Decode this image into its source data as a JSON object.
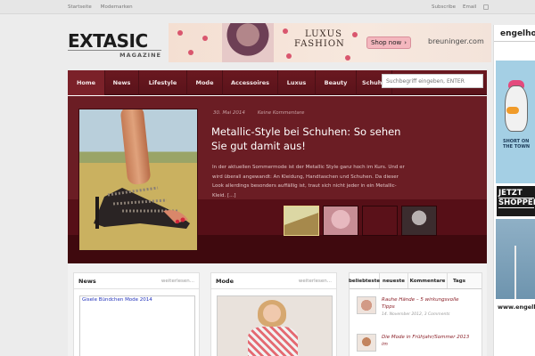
{
  "topbar": {
    "left_links": [
      "Startseite",
      "Modemarken"
    ],
    "right_links": [
      "Subscribe",
      "Email"
    ]
  },
  "logo": {
    "word": "EXTASIC",
    "sub": "MAGAZINE"
  },
  "banner": {
    "headline_1": "LUXUS",
    "headline_2": "FASHION",
    "button": "Shop now",
    "brand": "breuninger.com"
  },
  "skyscraper": {
    "brand": "engelhorn",
    "shirt_text": "SHORT ON THE TOWN",
    "cta_1": "JETZT",
    "cta_2": "SHOPPEN",
    "url": "www.engelhorn"
  },
  "nav": {
    "items": [
      "Home",
      "News",
      "Lifestyle",
      "Mode",
      "Accessoires",
      "Luxus",
      "Beauty",
      "Schuhe"
    ],
    "active": "Home",
    "search_placeholder": "Suchbegriff eingeben, ENTER"
  },
  "hero": {
    "date": "30. Mai 2014",
    "comments": "Keine Kommentare",
    "title": "Metallic-Style bei Schuhen: So sehen Sie gut damit aus!",
    "excerpt": "In der aktuellen Sommermode ist der Metallic Style ganz hoch im Kurs. Und er wird überall angewandt: An Kleidung, Handtaschen und Schuhen. Da dieser Look allerdings besonders auffällig ist, traut sich nicht jeder in ein Metallic-Kleid. [...]"
  },
  "news": {
    "title": "News",
    "more": "weiterlesen...",
    "link": "Gisele Bündchen Mode 2014"
  },
  "mode": {
    "title": "Mode",
    "more": "weiterlesen..."
  },
  "sidebar": {
    "tabs": [
      "beliebteste",
      "neueste",
      "Kommentare",
      "Tags"
    ],
    "posts": [
      {
        "title": "Rauhe Hände – 5 wirkungsvolle Tipps",
        "date": "14. November 2012, 3 Comments"
      },
      {
        "title": "Die Mode in Frühjahr/Sommer 2013 im",
        "date": ""
      }
    ]
  },
  "colors": {
    "nav_bg": "#5a131a",
    "hero_bg": "#6b1d24",
    "accent_link": "#8a1f27"
  }
}
